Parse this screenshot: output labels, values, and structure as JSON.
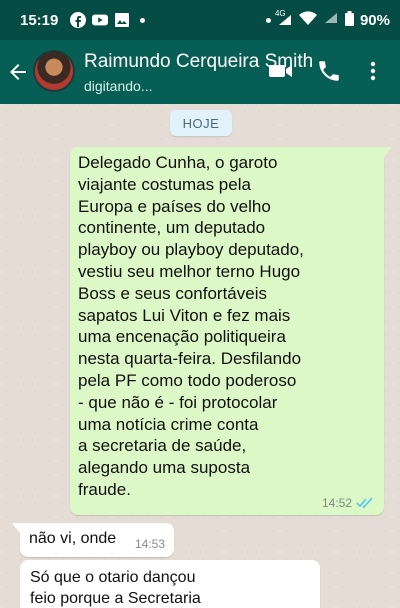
{
  "status_bar": {
    "time": "15:19",
    "signal_label": "4G",
    "battery": "90%",
    "icons": [
      "facebook-icon",
      "youtube-icon",
      "gallery-icon",
      "wifi-icon",
      "signal-icon",
      "battery-icon"
    ]
  },
  "header": {
    "contact_name": "Raimundo Cerqueira Smith",
    "status": "digitando...",
    "accent": "#075e54"
  },
  "chat": {
    "date_label": "HOJE",
    "messages": [
      {
        "direction": "outgoing",
        "text": "Delegado Cunha, o garoto\nviajante costumas pela\nEuropa e países do velho\ncontinente, um deputado\nplayboy ou playboy deputado,\nvestiu seu melhor terno Hugo\nBoss e seus confortáveis\nsapatos Lui Viton e fez mais\numa encenação politiqueira\nnesta quarta-feira. Desfilando\npela PF como todo poderoso\n- que não é - foi protocolar\numa notícia crime conta\na secretaria de saúde,\nalegando uma suposta\nfraude.",
        "time": "14:52",
        "read": true
      },
      {
        "direction": "incoming",
        "text": "não vi, onde",
        "time": "14:53"
      },
      {
        "direction": "incoming",
        "text": "Só que o otario dançou\nfeio porque a  Secretaria"
      }
    ]
  }
}
